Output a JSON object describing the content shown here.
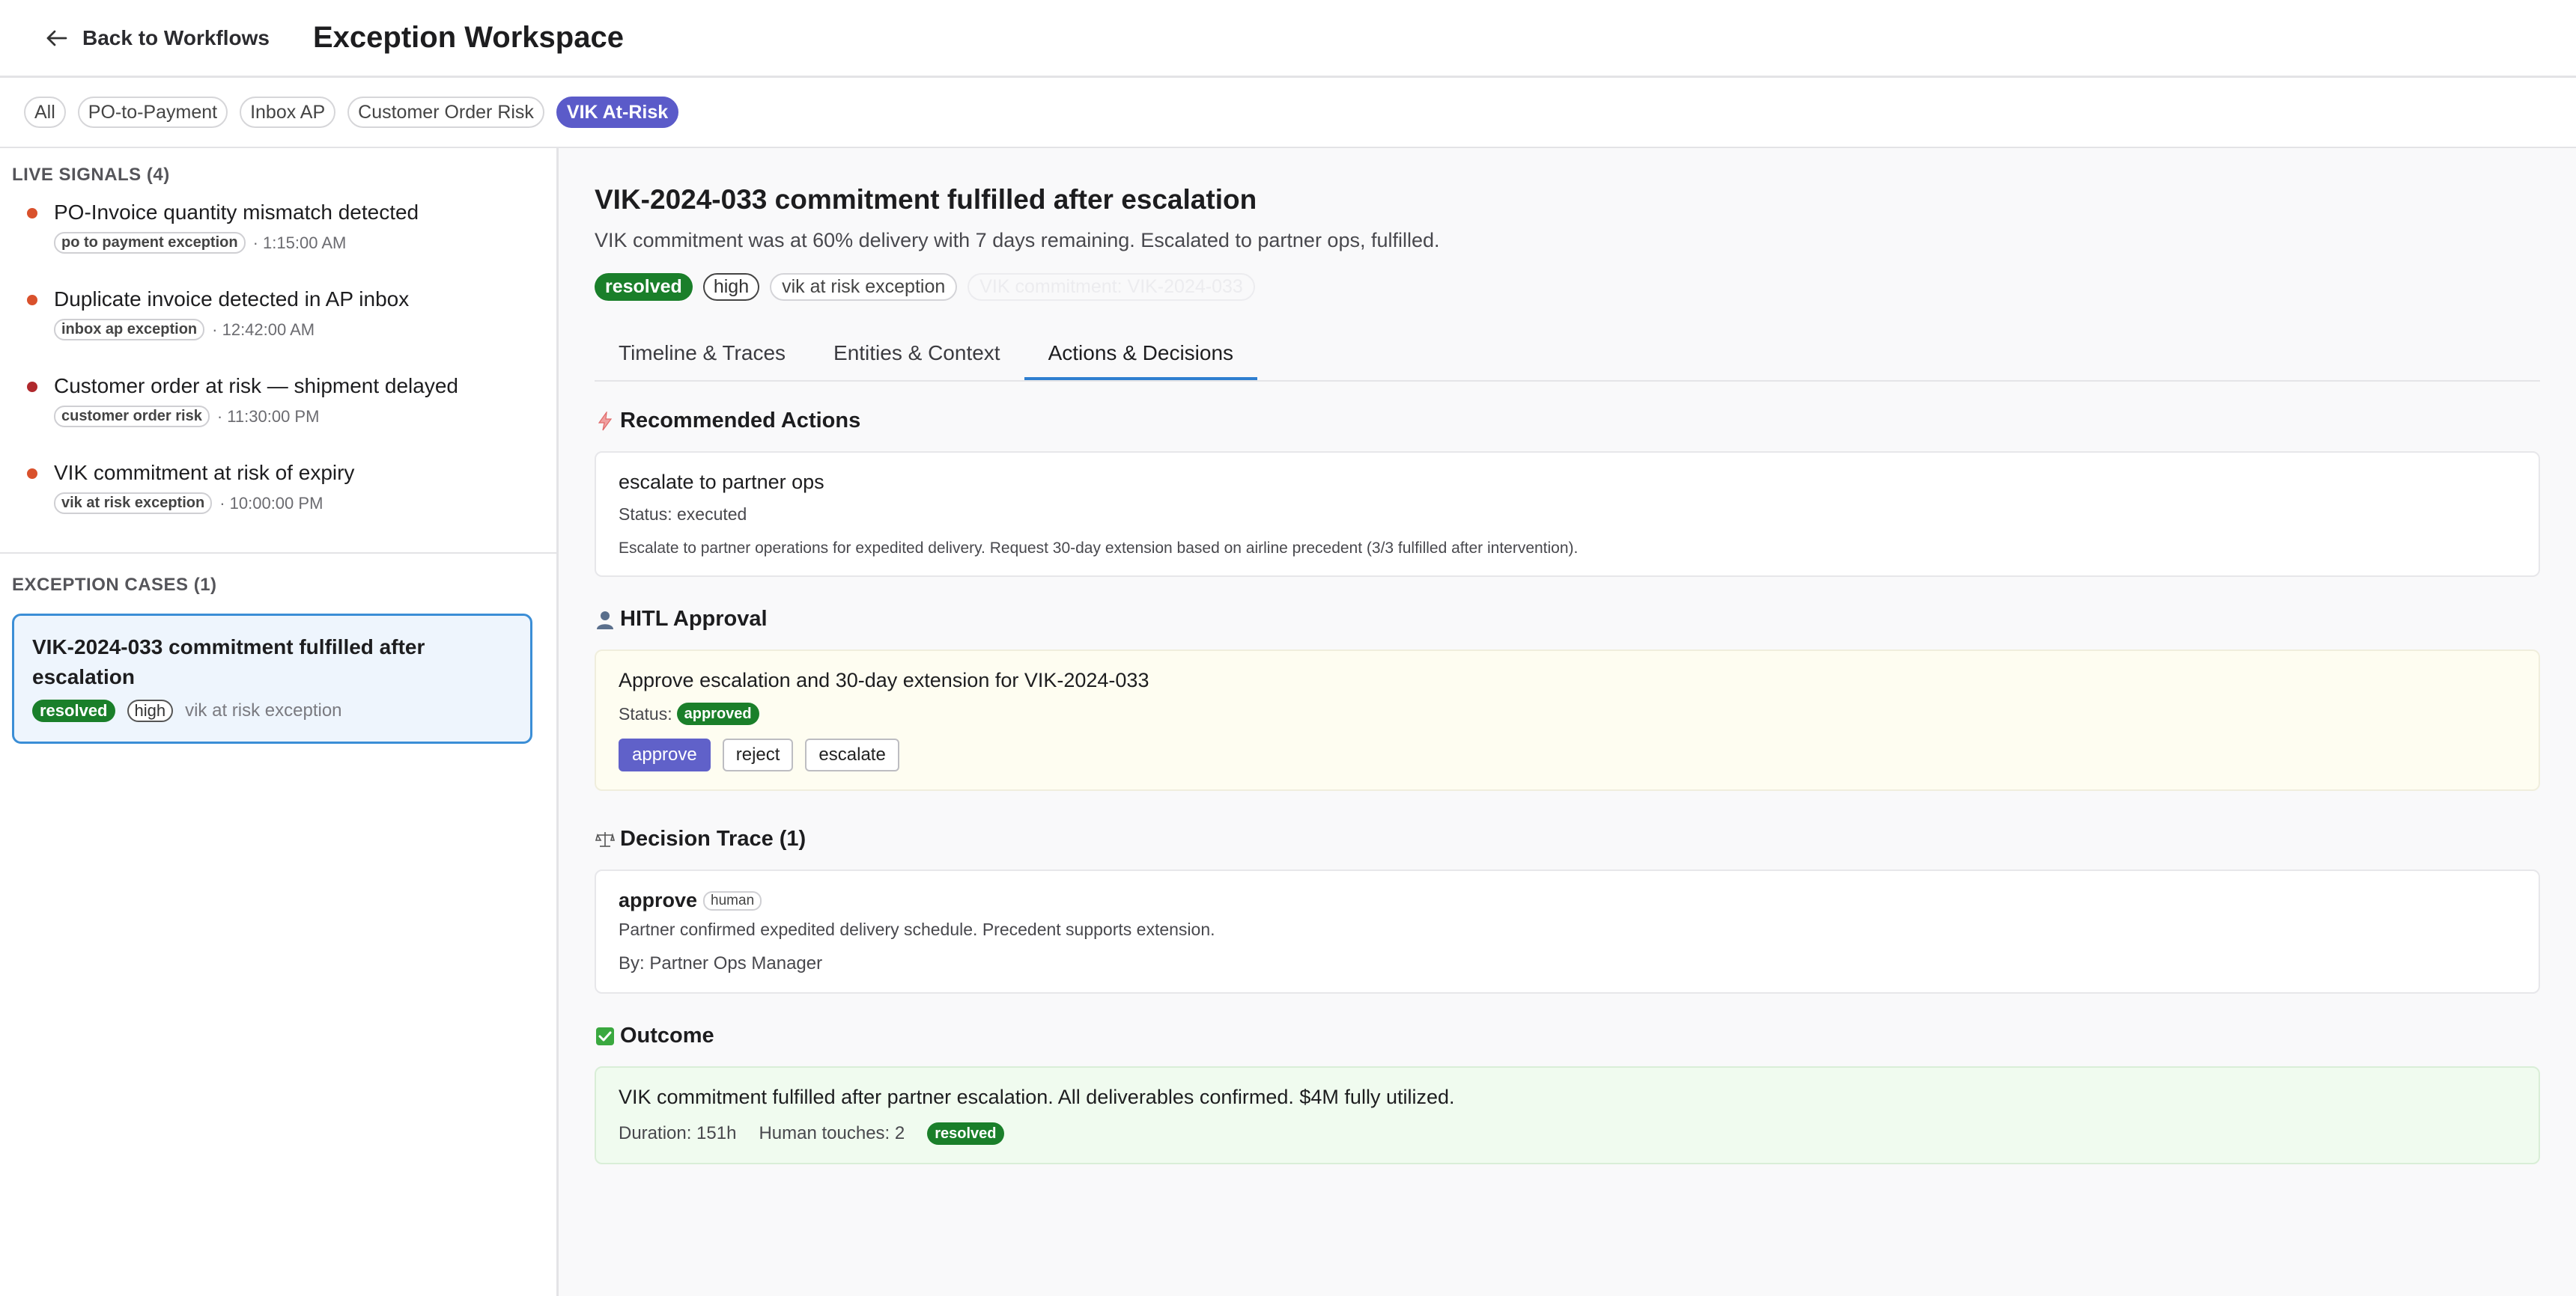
{
  "header": {
    "back_label": "Back to Workflows",
    "title": "Exception Workspace"
  },
  "filters": [
    "All",
    "PO-to-Payment",
    "Inbox AP",
    "Customer Order Risk",
    "VIK At-Risk"
  ],
  "active_filter": "VIK At-Risk",
  "sidebar": {
    "signals_title": "LIVE SIGNALS (4)",
    "signals": [
      {
        "title": "PO-Invoice quantity mismatch detected",
        "tag": "po to payment exception",
        "time": "· 1:15:00 AM",
        "color": "#d9512c"
      },
      {
        "title": "Duplicate invoice detected in AP inbox",
        "tag": "inbox ap exception",
        "time": "· 12:42:00 AM",
        "color": "#d9512c"
      },
      {
        "title": "Customer order at risk — shipment delayed",
        "tag": "customer order risk",
        "time": "· 11:30:00 PM",
        "color": "#b0292d"
      },
      {
        "title": "VIK commitment at risk of expiry",
        "tag": "vik at risk exception",
        "time": "· 10:00:00 PM",
        "color": "#d9512c"
      }
    ],
    "cases_title": "EXCEPTION CASES (1)",
    "case": {
      "title": "VIK-2024-033 commitment fulfilled after escalation",
      "status": "resolved",
      "priority": "high",
      "type": "vik at risk exception"
    }
  },
  "main": {
    "title": "VIK-2024-033 commitment fulfilled after escalation",
    "subtitle": "VIK commitment was at 60% delivery with 7 days remaining. Escalated to partner ops, fulfilled.",
    "badges": {
      "status": "resolved",
      "priority": "high",
      "type": "vik at risk exception",
      "ghost": "VIK commitment: VIK-2024-033"
    },
    "tabs": [
      "Timeline & Traces",
      "Entities & Context",
      "Actions & Decisions"
    ],
    "active_tab": "Actions & Decisions",
    "recommended": {
      "heading": "Recommended Actions",
      "icon": "lightning-icon",
      "title": "escalate to partner ops",
      "status": "Status: executed",
      "desc": "Escalate to partner operations for expedited delivery. Request 30-day extension based on airline precedent (3/3 fulfilled after intervention)."
    },
    "hitl": {
      "heading": "HITL Approval",
      "icon": "person-icon",
      "title": "Approve escalation and 30-day extension for VIK-2024-033",
      "status_label": "Status:",
      "status_value": "approved",
      "buttons": [
        "approve",
        "reject",
        "escalate"
      ]
    },
    "decision": {
      "heading": "Decision Trace (1)",
      "icon": "scales-icon",
      "action": "approve",
      "actor_type": "human",
      "reason": "Partner confirmed expedited delivery schedule. Precedent supports extension.",
      "by": "By: Partner Ops Manager"
    },
    "outcome": {
      "heading": "Outcome",
      "icon": "check-icon",
      "text": "VIK commitment fulfilled after partner escalation. All deliverables confirmed. $4M fully utilized.",
      "duration": "Duration: 151h",
      "touches": "Human touches: 2",
      "status": "resolved"
    }
  },
  "colors": {
    "accent": "#5b5bc9",
    "resolved": "#1a7f2a",
    "tab_underline": "#2f7fd0",
    "case_border": "#3b8ed6"
  }
}
